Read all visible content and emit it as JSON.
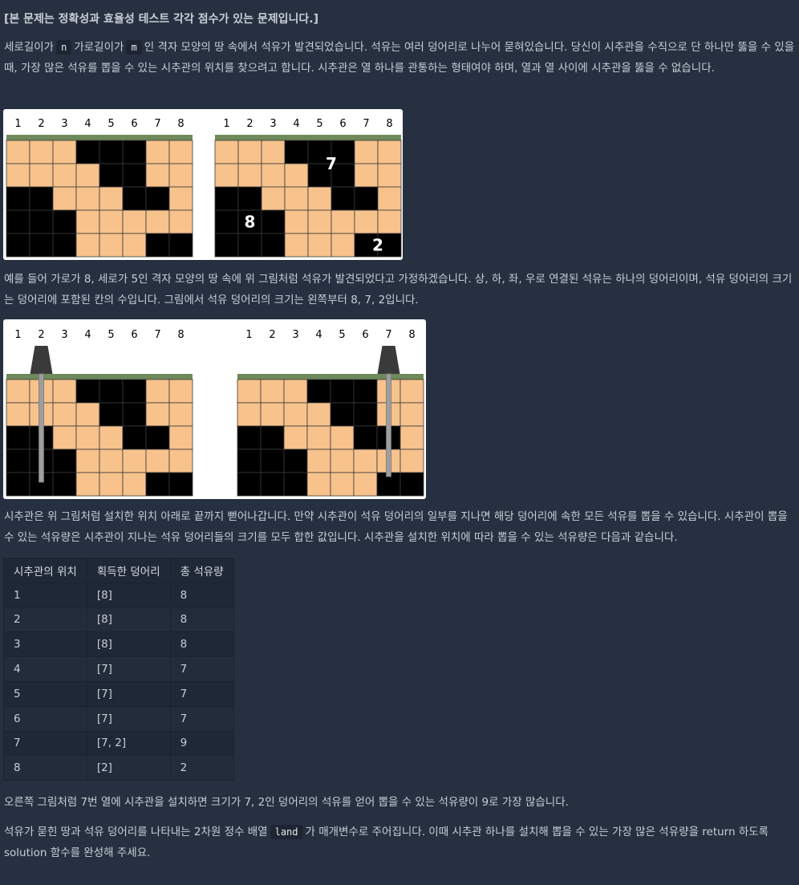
{
  "heading": "[본 문제는 정확성과 효율성 테스트 각각 점수가 있는 문제입니다.]",
  "intro": {
    "t1": "세로길이가",
    "n": "n",
    "t2": "가로길이가",
    "m": "m",
    "t3": "인 격자 모양의 땅 속에서 석유가 발견되었습니다. 석유는 여러 덩어리로 나누어 묻혀있습니다. 당신이 시추관을 수직으로 단 하나만 뚫을 수 있을 때, 가장 많은 석유를 뽑을 수 있는 시추관의 위치를 찾으려고 합니다. 시추관은 열 하나를 관통하는 형태여야 하며, 열과 열 사이에 시추관을 뚫을 수 없습니다."
  },
  "para2": "예를 들어 가로가 8, 세로가 5인 격자 모양의 땅 속에 위 그림처럼 석유가 발견되었다고 가정하겠습니다. 상, 하, 좌, 우로 연결된 석유는 하나의 덩어리이며, 석유 덩어리의 크기는 덩어리에 포함된 칸의 수입니다. 그림에서 석유 덩어리의 크기는 왼쪽부터 8, 7, 2입니다.",
  "para3": "시추관은 위 그림처럼 설치한 위치 아래로 끝까지 뻗어나갑니다. 만약 시추관이 석유 덩어리의 일부를 지나면 해당 덩어리에 속한 모든 석유를 뽑을 수 있습니다. 시추관이 뽑을 수 있는 석유량은 시추관이 지나는 석유 덩어리들의 크기를 모두 합한 값입니다. 시추관을 설치한 위치에 따라 뽑을 수 있는 석유량은 다음과 같습니다.",
  "para4": "오른쪽 그림처럼 7번 열에 시추관을 설치하면 크기가 7, 2인 덩어리의 석유를 얻어 뽑을 수 있는 석유량이 9로 가장 많습니다.",
  "para5": {
    "t1": "석유가 묻힌 땅과 석유 덩어리를 나타내는 2차원 정수 배열",
    "code": "land",
    "t2": "가 매개변수로 주어집니다. 이때 시추관 하나를 설치해 뽑을 수 있는 가장 많은 석유량을 return 하도록 solution 함수를 완성해 주세요."
  },
  "grid": {
    "columns": [
      "1",
      "2",
      "3",
      "4",
      "5",
      "6",
      "7",
      "8"
    ],
    "rows": [
      [
        0,
        0,
        0,
        1,
        1,
        1,
        0,
        0
      ],
      [
        0,
        0,
        0,
        0,
        1,
        1,
        0,
        0
      ],
      [
        1,
        1,
        0,
        0,
        0,
        1,
        1,
        0
      ],
      [
        1,
        1,
        1,
        0,
        0,
        0,
        0,
        0
      ],
      [
        1,
        1,
        1,
        0,
        0,
        0,
        1,
        1
      ]
    ],
    "blob_labels": [
      "7",
      "8",
      "2"
    ]
  },
  "table": {
    "headers": [
      "시추관의 위치",
      "획득한 덩어리",
      "총 석유량"
    ],
    "rows": [
      [
        "1",
        "[8]",
        "8"
      ],
      [
        "2",
        "[8]",
        "8"
      ],
      [
        "3",
        "[8]",
        "8"
      ],
      [
        "4",
        "[7]",
        "7"
      ],
      [
        "5",
        "[7]",
        "7"
      ],
      [
        "6",
        "[7]",
        "7"
      ],
      [
        "7",
        "[7, 2]",
        "9"
      ],
      [
        "8",
        "[2]",
        "2"
      ]
    ]
  },
  "colors": {
    "background": "#263040",
    "sand": "#f7c28c",
    "oil": "#000000",
    "grass": "#6f8a5a",
    "pipe": "#9e9e9e",
    "rig": "#3a3a3a"
  }
}
